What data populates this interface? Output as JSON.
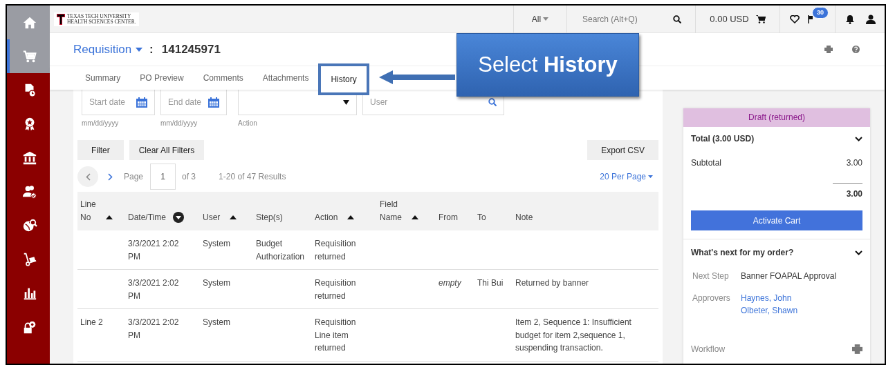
{
  "sidebar": {
    "items": [
      {
        "selected": false
      },
      {
        "selected": true
      },
      {
        "selected": false
      },
      {
        "selected": false
      },
      {
        "selected": false
      },
      {
        "selected": false
      },
      {
        "selected": false
      },
      {
        "selected": false
      },
      {
        "selected": false
      },
      {
        "selected": false
      }
    ]
  },
  "header": {
    "logo_lines": [
      "TEXAS TECH UNIVERSITY",
      "HEALTH SCIENCES CENTER."
    ],
    "search_scope": "All",
    "search_placeholder": "Search (Alt+Q)",
    "cart_total": "0.00 USD",
    "notification_count": "30"
  },
  "title": {
    "doc_type": "Requisition",
    "separator": ":",
    "number": "141245971"
  },
  "tabs": [
    {
      "label": "Summary",
      "selected": false
    },
    {
      "label": "PO Preview",
      "selected": false
    },
    {
      "label": "Comments",
      "selected": false
    },
    {
      "label": "Attachments",
      "selected": false
    },
    {
      "label": "History",
      "selected": true
    }
  ],
  "callout": {
    "text": "Select **History**"
  },
  "filters": {
    "start_date": {
      "placeholder": "Start date",
      "hint": "mm/dd/yyyy"
    },
    "end_date": {
      "placeholder": "End date",
      "hint": "mm/dd/yyyy"
    },
    "action": {
      "hint": "Action"
    },
    "user": {
      "placeholder": "User"
    }
  },
  "buttons": {
    "filter": "Filter",
    "clear": "Clear All Filters",
    "export": "Export CSV"
  },
  "pagination": {
    "page_label": "Page",
    "page": "1",
    "of": "of 3",
    "results": "1-20 of 47 Results",
    "per_page": "20 Per Page"
  },
  "table": {
    "columns": [
      {
        "lines": [
          "Line",
          "No"
        ],
        "sortable": true,
        "sorted": false
      },
      {
        "lines": [
          "Date/Time"
        ],
        "sortable": true,
        "sorted": true
      },
      {
        "lines": [
          "User"
        ],
        "sortable": true,
        "sorted": false
      },
      {
        "lines": [
          "Step(s)"
        ],
        "sortable": false,
        "sorted": false
      },
      {
        "lines": [
          "Action"
        ],
        "sortable": true,
        "sorted": false
      },
      {
        "lines": [
          "Field",
          "Name"
        ],
        "sortable": true,
        "sorted": false
      },
      {
        "lines": [
          "From"
        ],
        "sortable": false,
        "sorted": false
      },
      {
        "lines": [
          "To"
        ],
        "sortable": false,
        "sorted": false
      },
      {
        "lines": [
          "Note"
        ],
        "sortable": false,
        "sorted": false
      }
    ],
    "rows": [
      {
        "line_no": "",
        "date": [
          "3/3/2021 2:02",
          "PM"
        ],
        "user": "System",
        "steps": [
          "Budget",
          "Authorization"
        ],
        "action": [
          "Requisition",
          "returned"
        ],
        "note": []
      },
      {
        "line_no": "",
        "date": [
          "3/3/2021 2:02",
          "PM"
        ],
        "user": "System",
        "steps": [],
        "action": [
          "Requisition",
          "returned"
        ],
        "from": "empty",
        "from_empty": true,
        "to": "Thi Bui",
        "note": [
          "Returned by banner"
        ]
      },
      {
        "line_no": "Line 2",
        "date": [
          "3/3/2021 2:02",
          "PM"
        ],
        "user": "System",
        "steps": [],
        "action": [
          "Requisition",
          "Line item",
          "returned"
        ],
        "note": [
          "Item 2, Sequence 1: Insufficient",
          "budget for item 2,sequence 1,",
          "suspending transaction."
        ]
      }
    ]
  },
  "summary": {
    "status": "Draft (returned)",
    "total_label": "Total (3.00 USD)",
    "subtotal_label": "Subtotal",
    "subtotal": "3.00",
    "total": "3.00",
    "activate_button": "Activate Cart",
    "next_title": "What's next for my order?",
    "next_step_label": "Next Step",
    "next_step": "Banner FOAPAL Approval",
    "approvers_label": "Approvers",
    "approvers": [
      "Haynes, John",
      "Olbeter, Shawn"
    ],
    "workflow_label": "Workflow"
  }
}
